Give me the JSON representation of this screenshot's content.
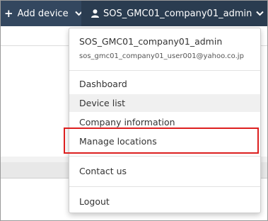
{
  "navbar": {
    "add_device_label": "Add device",
    "add_icon": "plus-icon",
    "user_label": "SOS_GMC01_company01_admin",
    "user_icon": "user-icon",
    "caret_icon": "chevron-down-icon",
    "bg_color": "#33475f",
    "user_bg_color": "#2a3c50"
  },
  "dropdown": {
    "account_name": "SOS_GMC01_company01_admin",
    "account_email": "sos_gmc01_company01_user001@yahoo.co.jp",
    "items": [
      {
        "label": "Dashboard"
      },
      {
        "label": "Device list"
      },
      {
        "label": "Company information"
      },
      {
        "label": "Manage locations"
      },
      {
        "label": "Contact us"
      },
      {
        "label": "Logout"
      }
    ],
    "highlight_color": "#dd1f1f"
  }
}
